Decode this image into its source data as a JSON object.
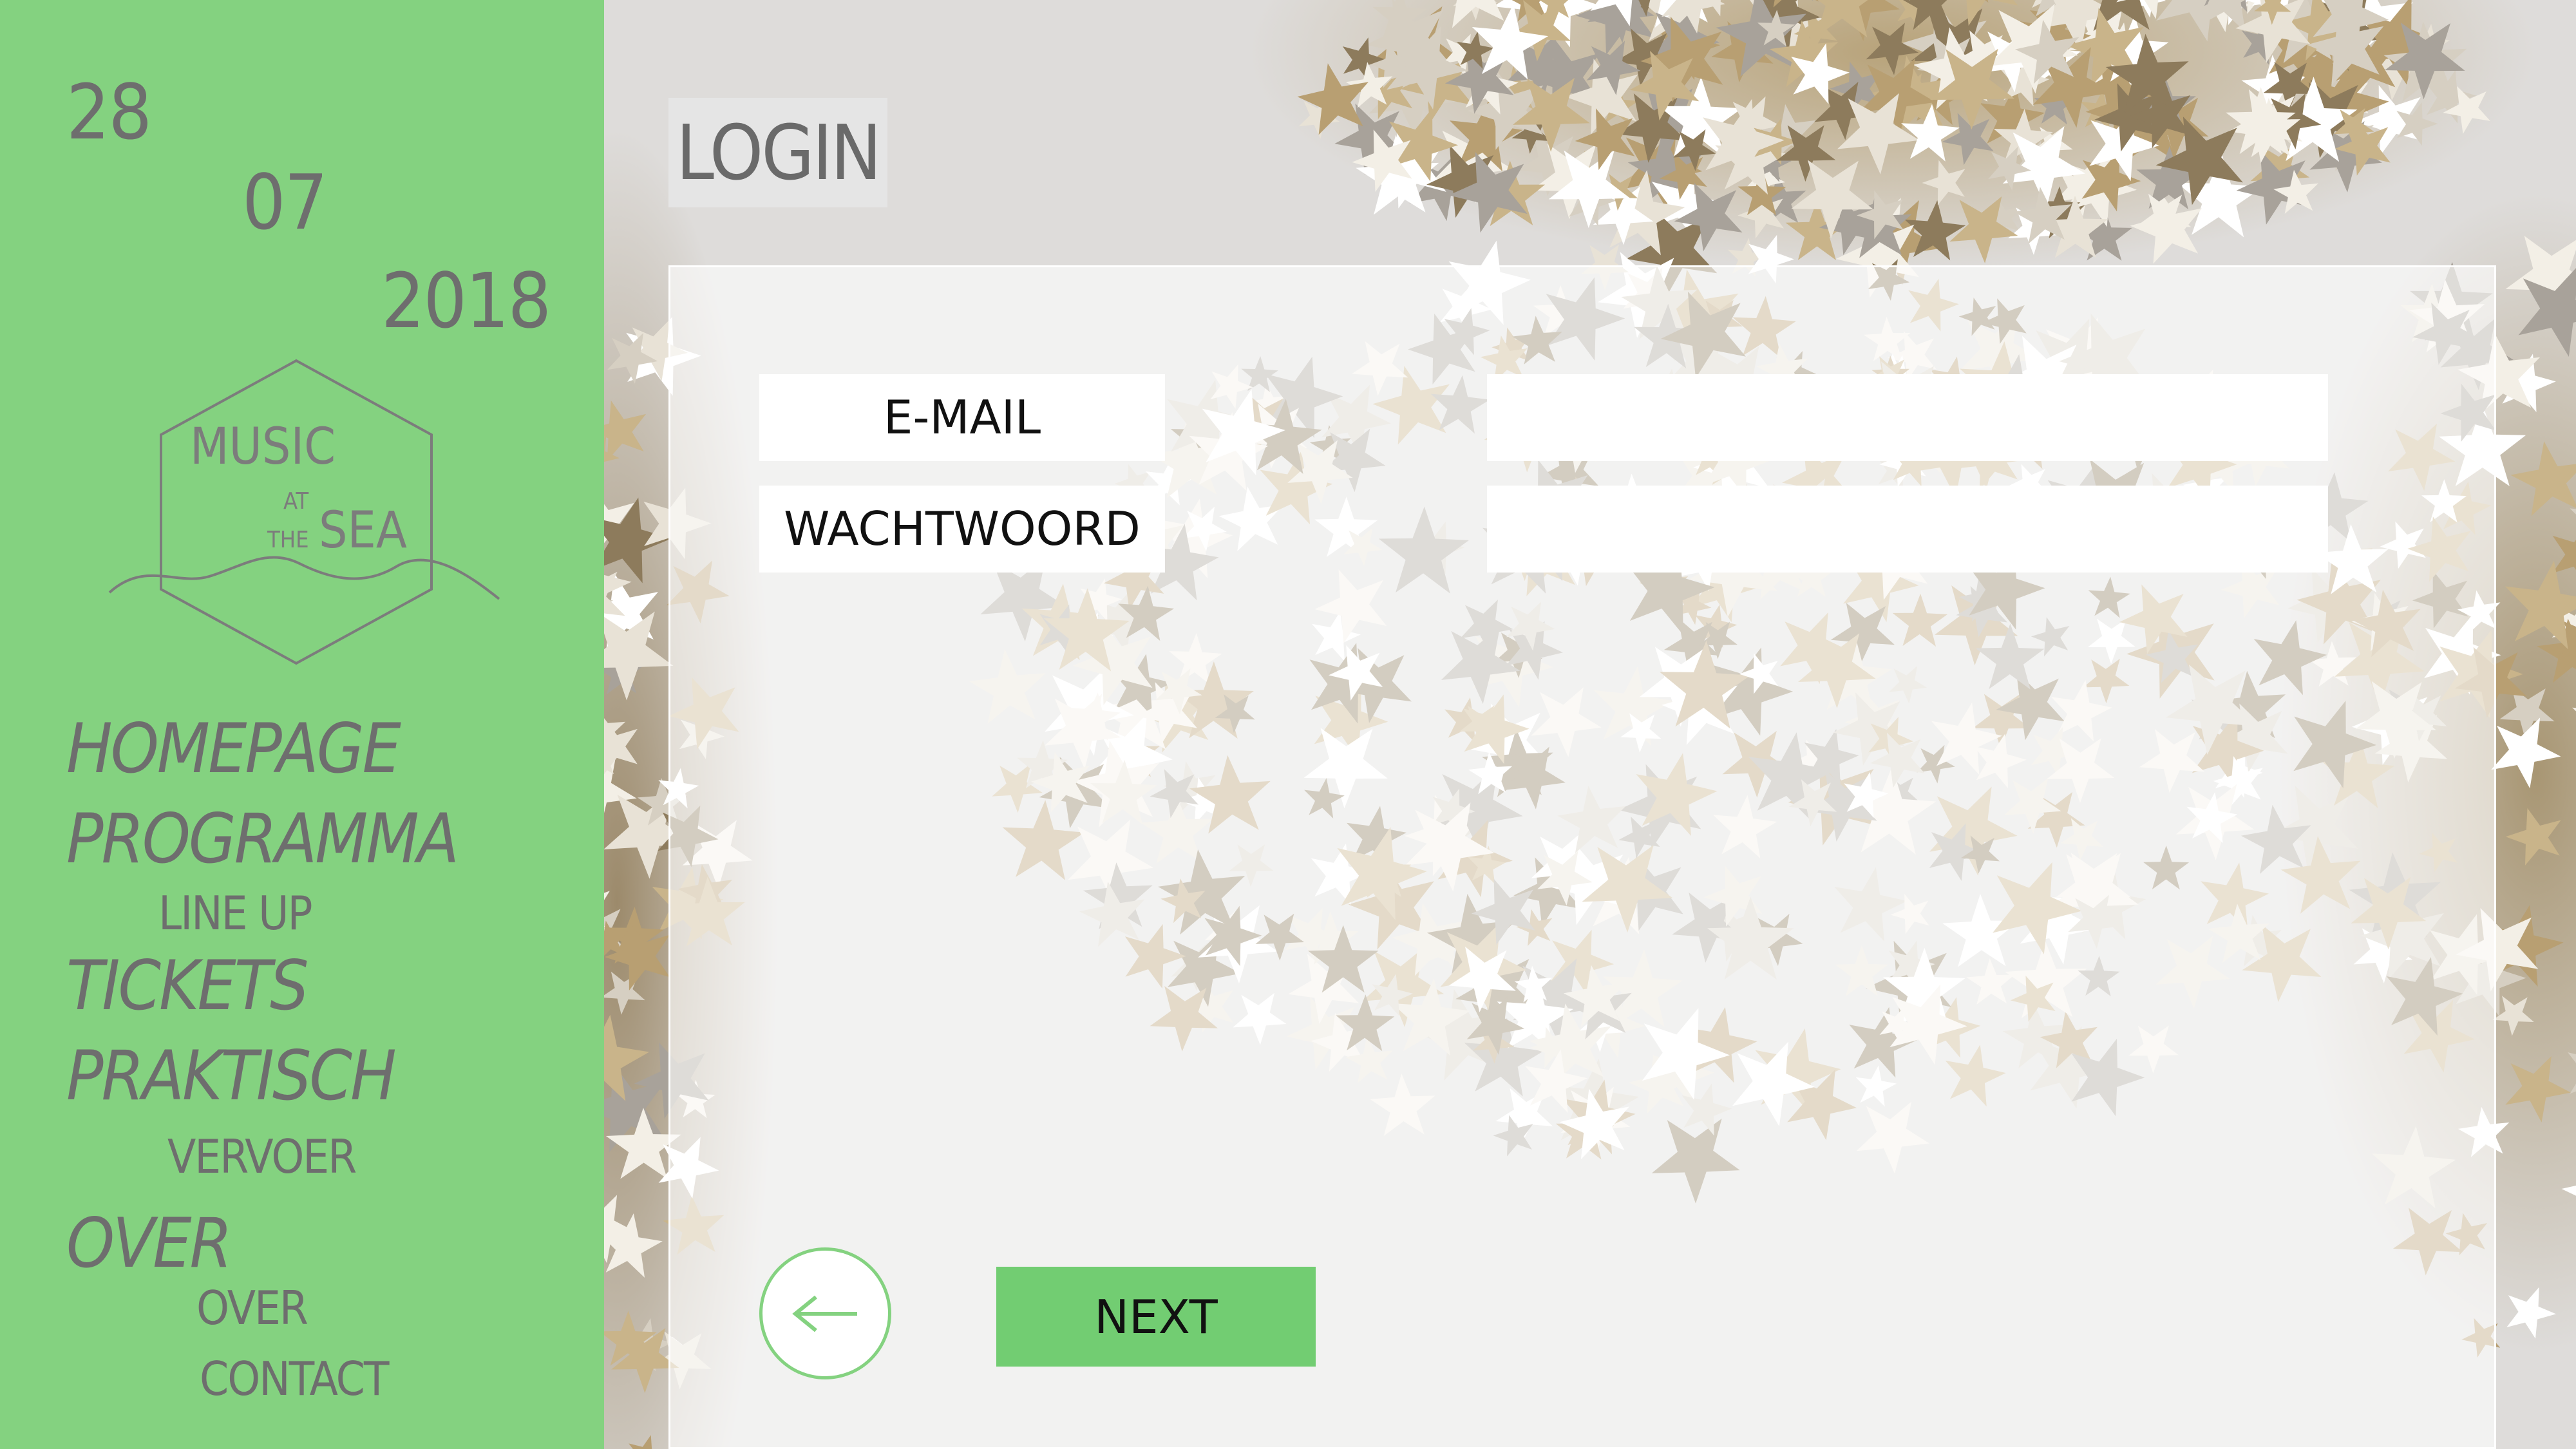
{
  "sidebar": {
    "date": {
      "day": "28",
      "month": "07",
      "year": "2018"
    },
    "logo": {
      "line1": "MUSIC",
      "at": "AT",
      "the": "THE",
      "sea": "SEA"
    },
    "nav": [
      {
        "label": "HOMEPAGE",
        "level": "main"
      },
      {
        "label": "PROGRAMMA",
        "level": "main"
      },
      {
        "label": "LINE UP",
        "level": "sub"
      },
      {
        "label": "TICKETS",
        "level": "main"
      },
      {
        "label": "PRAKTISCH",
        "level": "main"
      },
      {
        "label": "VERVOER",
        "level": "sub"
      },
      {
        "label": "OVER",
        "level": "main"
      },
      {
        "label": "OVER",
        "level": "sub"
      },
      {
        "label": "CONTACT",
        "level": "sub"
      }
    ]
  },
  "main": {
    "title": "LOGIN",
    "form": {
      "email_label": "E-MAIL",
      "email_value": "",
      "password_label": "WACHTWOORD",
      "password_value": ""
    },
    "buttons": {
      "back_icon": "arrow-left-icon",
      "next_label": "NEXT"
    }
  },
  "colors": {
    "sidebar_bg": "#84d280",
    "accent": "#72cd72",
    "text_grey": "#6e6e6e"
  }
}
